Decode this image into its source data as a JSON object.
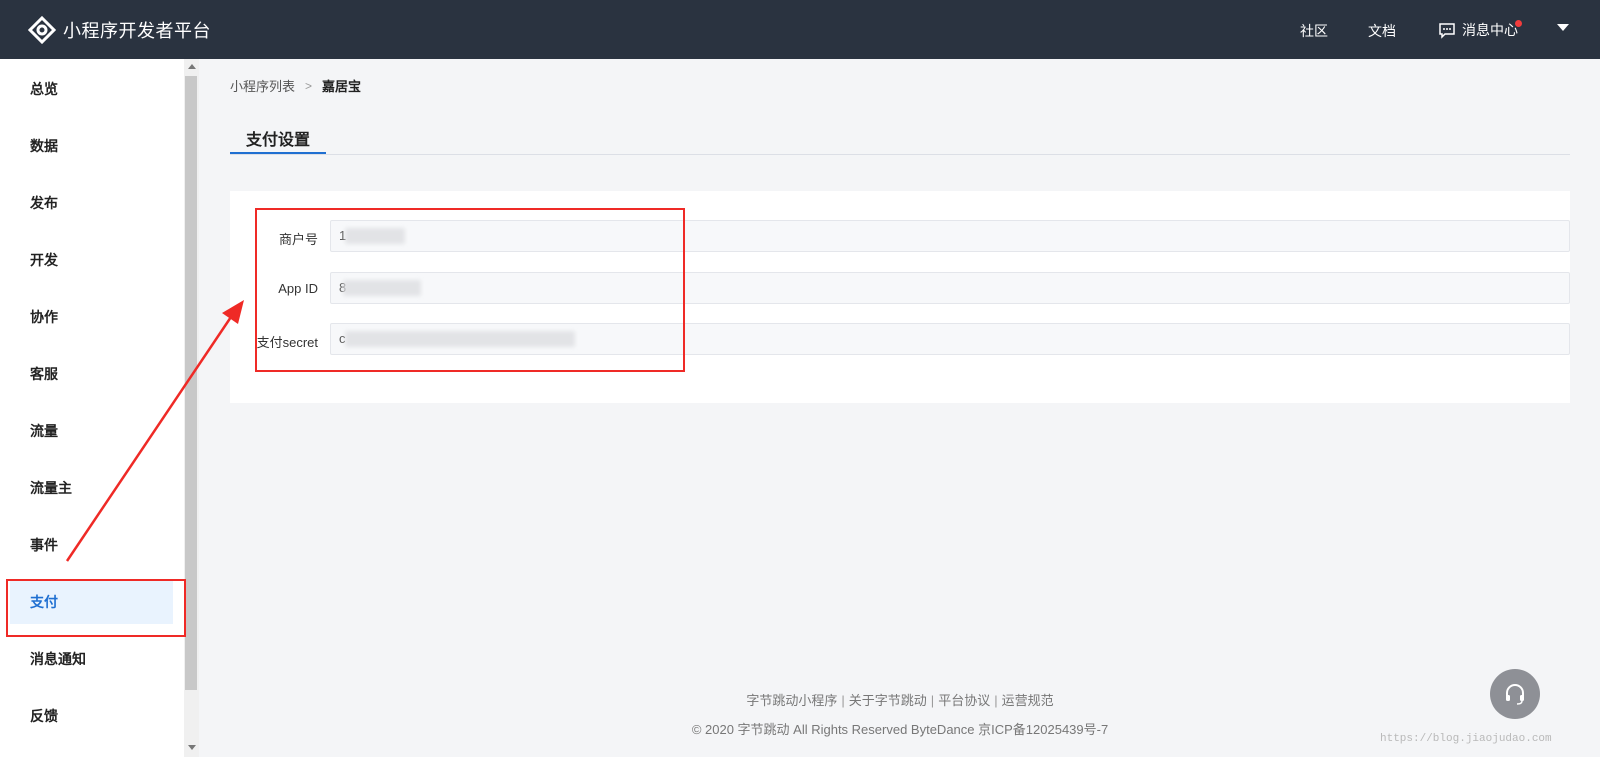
{
  "header": {
    "brand": "小程序开发者平台",
    "nav": {
      "community": "社区",
      "docs": "文档",
      "messages": "消息中心"
    },
    "accent": "#2a3340"
  },
  "sidebar": {
    "items": [
      {
        "label": "总览"
      },
      {
        "label": "数据"
      },
      {
        "label": "发布"
      },
      {
        "label": "开发"
      },
      {
        "label": "协作"
      },
      {
        "label": "客服"
      },
      {
        "label": "流量"
      },
      {
        "label": "流量主"
      },
      {
        "label": "事件"
      },
      {
        "label": "支付",
        "active": true
      },
      {
        "label": "消息通知"
      },
      {
        "label": "反馈"
      }
    ],
    "active_color": "#1f6fd1"
  },
  "breadcrumb": {
    "parent": "小程序列表",
    "current": "嘉居宝"
  },
  "tabs": {
    "active": "支付设置"
  },
  "form": {
    "fields": [
      {
        "label": "商户号",
        "value": "1"
      },
      {
        "label": "App ID",
        "value": "8"
      },
      {
        "label": "支付secret",
        "value": "c"
      }
    ]
  },
  "footer": {
    "links": [
      "字节跳动小程序",
      "关于字节跳动",
      "平台协议",
      "运营规范"
    ],
    "copyright": "© 2020 字节跳动 All Rights Reserved ByteDance 京ICP备12025439号-7"
  },
  "watermark": "https://blog.jiaojudao.com",
  "annotation_color": "#ef2a26"
}
